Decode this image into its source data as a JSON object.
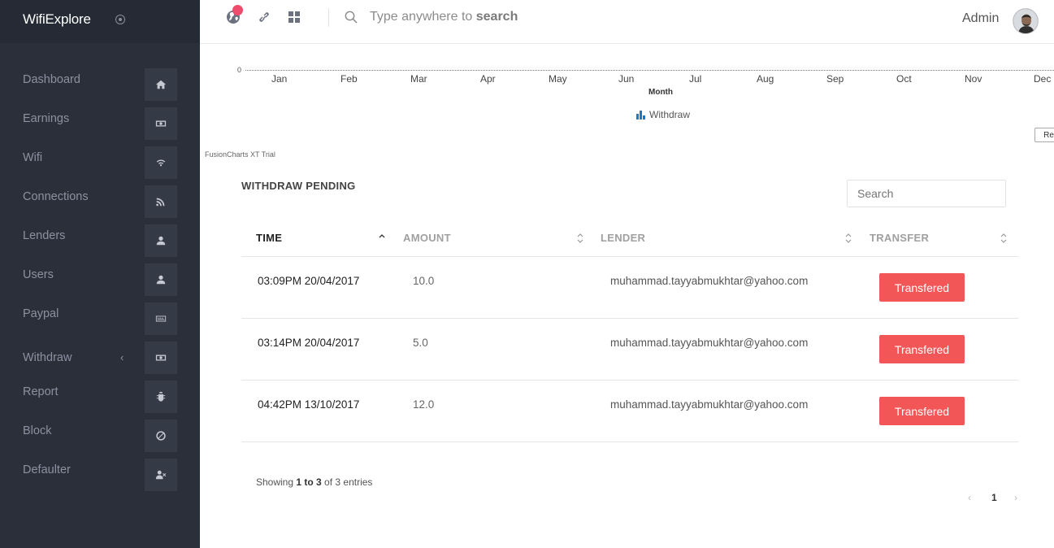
{
  "app": {
    "brand": "WifiExplore"
  },
  "sidebar": {
    "items": [
      {
        "label": "Dashboard",
        "icon": "home-icon"
      },
      {
        "label": "Earnings",
        "icon": "money-icon"
      },
      {
        "label": "Wifi",
        "icon": "wifi-icon"
      },
      {
        "label": "Connections",
        "icon": "rss-icon"
      },
      {
        "label": "Lenders",
        "icon": "user-icon"
      },
      {
        "label": "Users",
        "icon": "user-icon"
      },
      {
        "label": "Paypal",
        "icon": "paypal-icon"
      },
      {
        "label": "Withdraw",
        "icon": "money-icon",
        "has_submenu": true
      },
      {
        "label": "Report",
        "icon": "bug-icon"
      },
      {
        "label": "Block",
        "icon": "ban-icon"
      },
      {
        "label": "Defaulter",
        "icon": "user-times-icon"
      }
    ]
  },
  "topbar": {
    "search_prefix": "Type anywhere to ",
    "search_emphasis": "search",
    "user_name": "Admin",
    "icons": [
      "globe-icon",
      "link-icon",
      "grid-icon",
      "search-icon"
    ],
    "notification_color": "#ef4b6c"
  },
  "chart": {
    "zero_label": "0",
    "months": [
      "Jan",
      "Feb",
      "Mar",
      "Apr",
      "May",
      "Jun",
      "Jul",
      "Aug",
      "Sep",
      "Oct",
      "Nov",
      "Dec"
    ],
    "xlabel": "Month",
    "legend": "Withdraw",
    "legend_color": "#1e78c2",
    "reset_label": "Res",
    "watermark": "FusionCharts XT Trial"
  },
  "table": {
    "title": "WITHDRAW PENDING",
    "search_placeholder": "Search",
    "headers": {
      "time": "TIME",
      "amount": "AMOUNT",
      "lender": "LENDER",
      "transfer": "TRANSFER"
    },
    "rows": [
      {
        "time": "03:09PM 20/04/2017",
        "amount": "10.0",
        "lender": "muhammad.tayyabmukhtar@yahoo.com",
        "action": "Transfered"
      },
      {
        "time": "03:14PM 20/04/2017",
        "amount": "5.0",
        "lender": "muhammad.tayyabmukhtar@yahoo.com",
        "action": "Transfered"
      },
      {
        "time": "04:42PM 13/10/2017",
        "amount": "12.0",
        "lender": "muhammad.tayyabmukhtar@yahoo.com",
        "action": "Transfered"
      }
    ],
    "info": {
      "prefix": "Showing ",
      "range": "1 to 3",
      "suffix": " of 3 entries"
    },
    "pagination": {
      "prev": "‹",
      "current": "1",
      "next": "›"
    },
    "action_color": "#f25656"
  },
  "colors": {
    "sidebar_bg": "#2b2f3a",
    "sidebar_header_bg": "#262a35"
  }
}
